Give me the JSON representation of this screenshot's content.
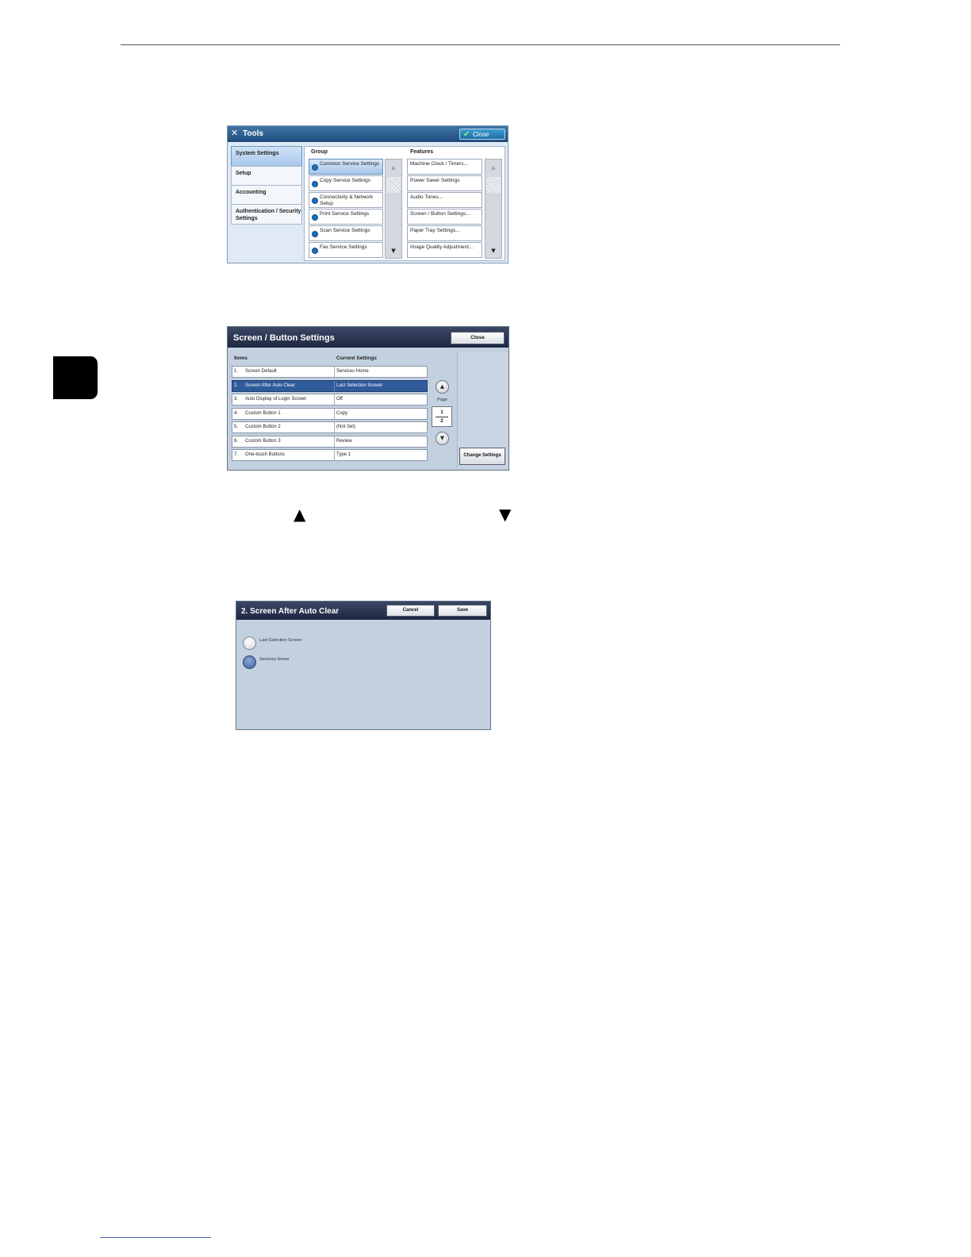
{
  "tools_screen": {
    "title": "Tools",
    "close_label": "Close",
    "nav": [
      {
        "label": "System Settings"
      },
      {
        "label": "Setup"
      },
      {
        "label": "Accounting"
      },
      {
        "label": "Authentication / Security Settings"
      }
    ],
    "group_header": "Group",
    "features_header": "Features",
    "groups": [
      {
        "label": "Common Service Settings"
      },
      {
        "label": "Copy Service Settings"
      },
      {
        "label": "Connectivity & Network Setup"
      },
      {
        "label": "Print Service Settings"
      },
      {
        "label": "Scan Service Settings"
      },
      {
        "label": "Fax Service Settings"
      }
    ],
    "features": [
      {
        "label": "Machine Clock / Timers..."
      },
      {
        "label": "Power Saver Settings"
      },
      {
        "label": "Audio Tones..."
      },
      {
        "label": "Screen / Button Settings..."
      },
      {
        "label": "Paper Tray Settings..."
      },
      {
        "label": "Image Quality Adjustment..."
      }
    ],
    "colors": {
      "titlebar": "#1e4c7c",
      "selected": "#a9c8ea"
    }
  },
  "screen_button_settings": {
    "title": "Screen / Button Settings",
    "close_label": "Close",
    "items_header": "Items",
    "current_header": "Current Settings",
    "rows": [
      {
        "num": "1.",
        "item": "Screen Default",
        "value": "Services Home"
      },
      {
        "num": "2.",
        "item": "Screen After Auto Clear",
        "value": "Last Selection Screen"
      },
      {
        "num": "3.",
        "item": "Auto Display of Login Screen",
        "value": "Off"
      },
      {
        "num": "4.",
        "item": "Custom Button 1",
        "value": "Copy"
      },
      {
        "num": "5.",
        "item": "Custom Button 2",
        "value": "(Not Set)"
      },
      {
        "num": "6.",
        "item": "Custom Button 3",
        "value": "Review"
      },
      {
        "num": "7.",
        "item": "One-touch Buttons",
        "value": "Type 1"
      }
    ],
    "page_label": "Page",
    "page_current": "1",
    "page_total": "2",
    "change_label": "Change Settings",
    "colors": {
      "titlebar": "#1e2841",
      "selected_row": "#2f5b9a"
    }
  },
  "screen_after_auto_clear": {
    "title": "2. Screen After Auto Clear",
    "cancel_label": "Cancel",
    "save_label": "Save",
    "options": [
      {
        "label": "Last Selection Screen"
      },
      {
        "label": "Services Home"
      }
    ]
  }
}
